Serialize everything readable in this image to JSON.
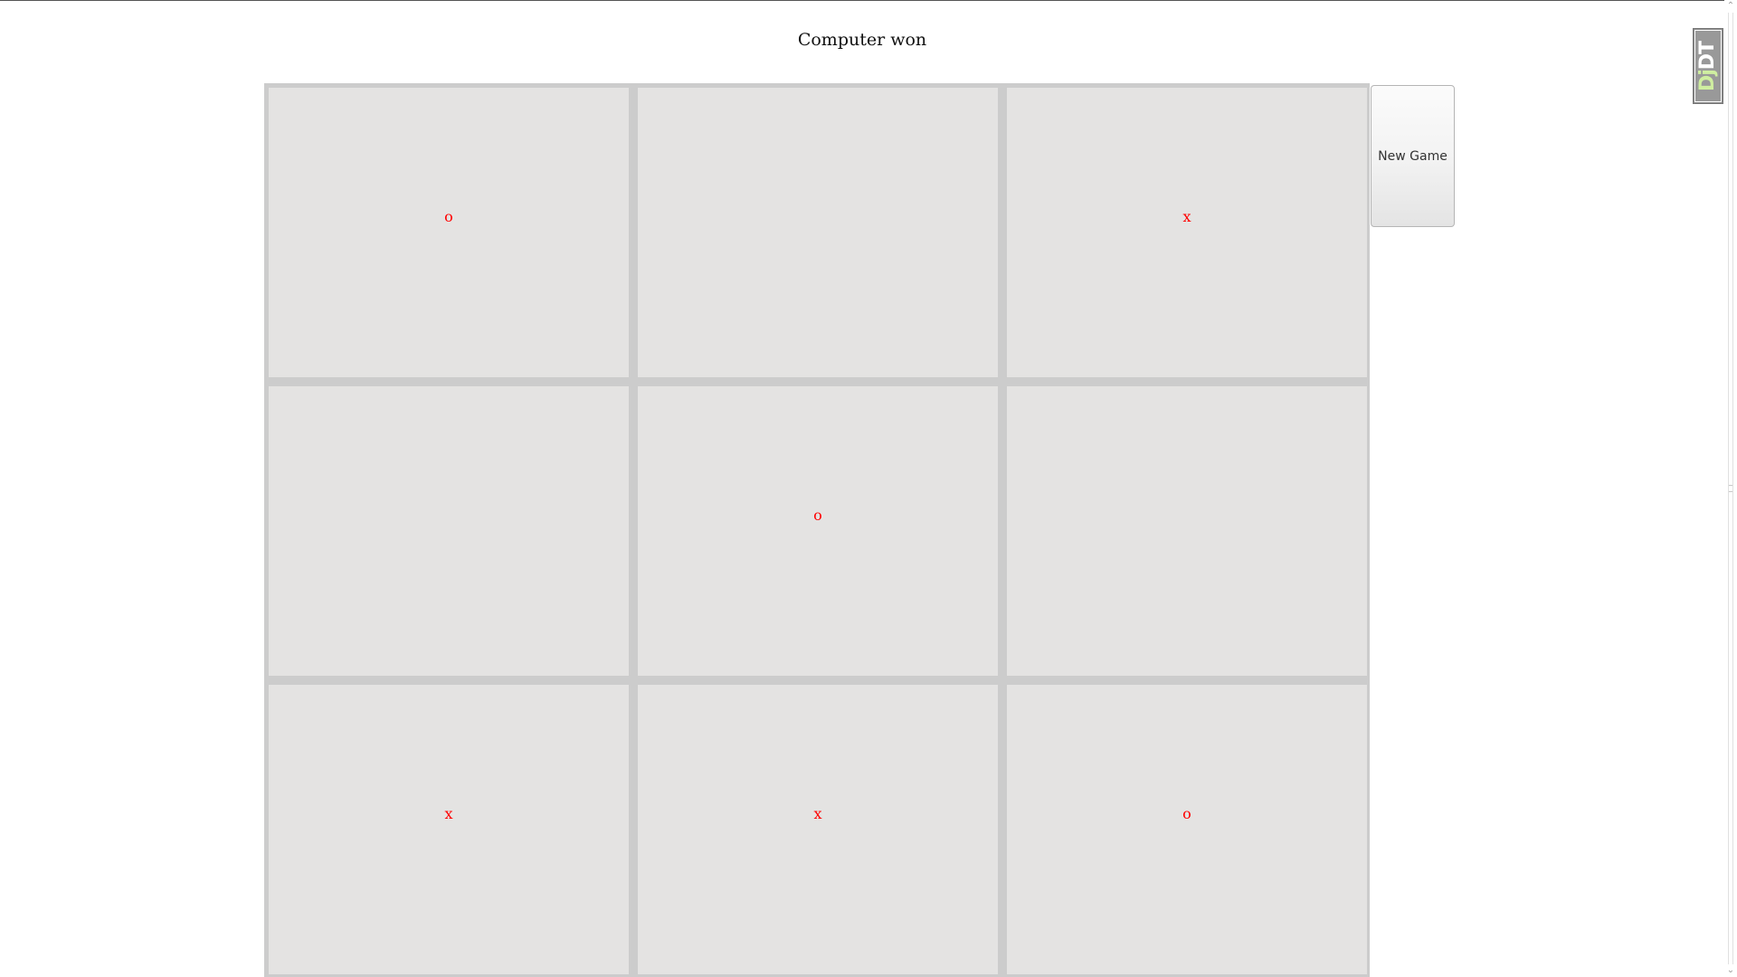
{
  "status_text": "Computer won",
  "new_game_label": "New Game",
  "board": {
    "cells": [
      "o",
      "",
      "x",
      "",
      "o",
      "",
      "x",
      "x",
      "o"
    ]
  },
  "debug_toolbar": {
    "label_prefix": "Dj",
    "label_suffix": "DT"
  },
  "colors": {
    "mark": "#ff0000",
    "cell_background": "#e4e3e2",
    "board_gap": "#cccccc"
  }
}
